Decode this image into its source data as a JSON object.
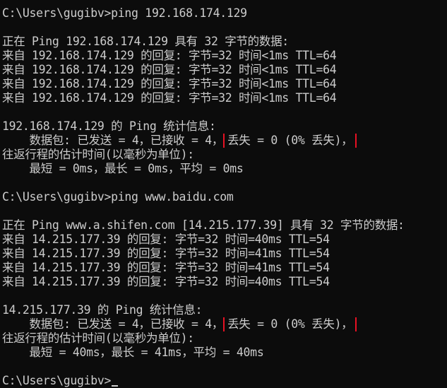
{
  "console": {
    "prompt1": "C:\\Users\\gugibv>ping 192.168.174.129",
    "ping1_header": "正在 Ping 192.168.174.129 具有 32 字节的数据:",
    "ping1_replies": [
      "来自 192.168.174.129 的回复: 字节=32 时间<1ms TTL=64",
      "来自 192.168.174.129 的回复: 字节=32 时间<1ms TTL=64",
      "来自 192.168.174.129 的回复: 字节=32 时间<1ms TTL=64",
      "来自 192.168.174.129 的回复: 字节=32 时间<1ms TTL=64"
    ],
    "ping1_stats_title": "192.168.174.129 的 Ping 统计信息:",
    "ping1_packets": "    数据包: 已发送 = 4，已接收 = 4，",
    "ping1_loss": "丢失 = 0 (0% 丢失)，",
    "ping1_rtt_title": "往返行程的估计时间(以毫秒为单位):",
    "ping1_rtt": "    最短 = 0ms，最长 = 0ms，平均 = 0ms",
    "prompt2": "C:\\Users\\gugibv>ping www.baidu.com",
    "ping2_header": "正在 Ping www.a.shifen.com [14.215.177.39] 具有 32 字节的数据:",
    "ping2_replies": [
      "来自 14.215.177.39 的回复: 字节=32 时间=40ms TTL=54",
      "来自 14.215.177.39 的回复: 字节=32 时间=41ms TTL=54",
      "来自 14.215.177.39 的回复: 字节=32 时间=41ms TTL=54",
      "来自 14.215.177.39 的回复: 字节=32 时间=40ms TTL=54"
    ],
    "ping2_stats_title": "14.215.177.39 的 Ping 统计信息:",
    "ping2_packets": "    数据包: 已发送 = 4，已接收 = 4，",
    "ping2_loss": "丢失 = 0 (0% 丢失)，",
    "ping2_rtt_title": "往返行程的估计时间(以毫秒为单位):",
    "ping2_rtt": "    最短 = 40ms，最长 = 41ms，平均 = 40ms",
    "prompt3": "C:\\Users\\gugibv>"
  },
  "colors": {
    "background": "#0c0c0c",
    "text": "#cccccc",
    "highlight_box": "#e81123"
  }
}
